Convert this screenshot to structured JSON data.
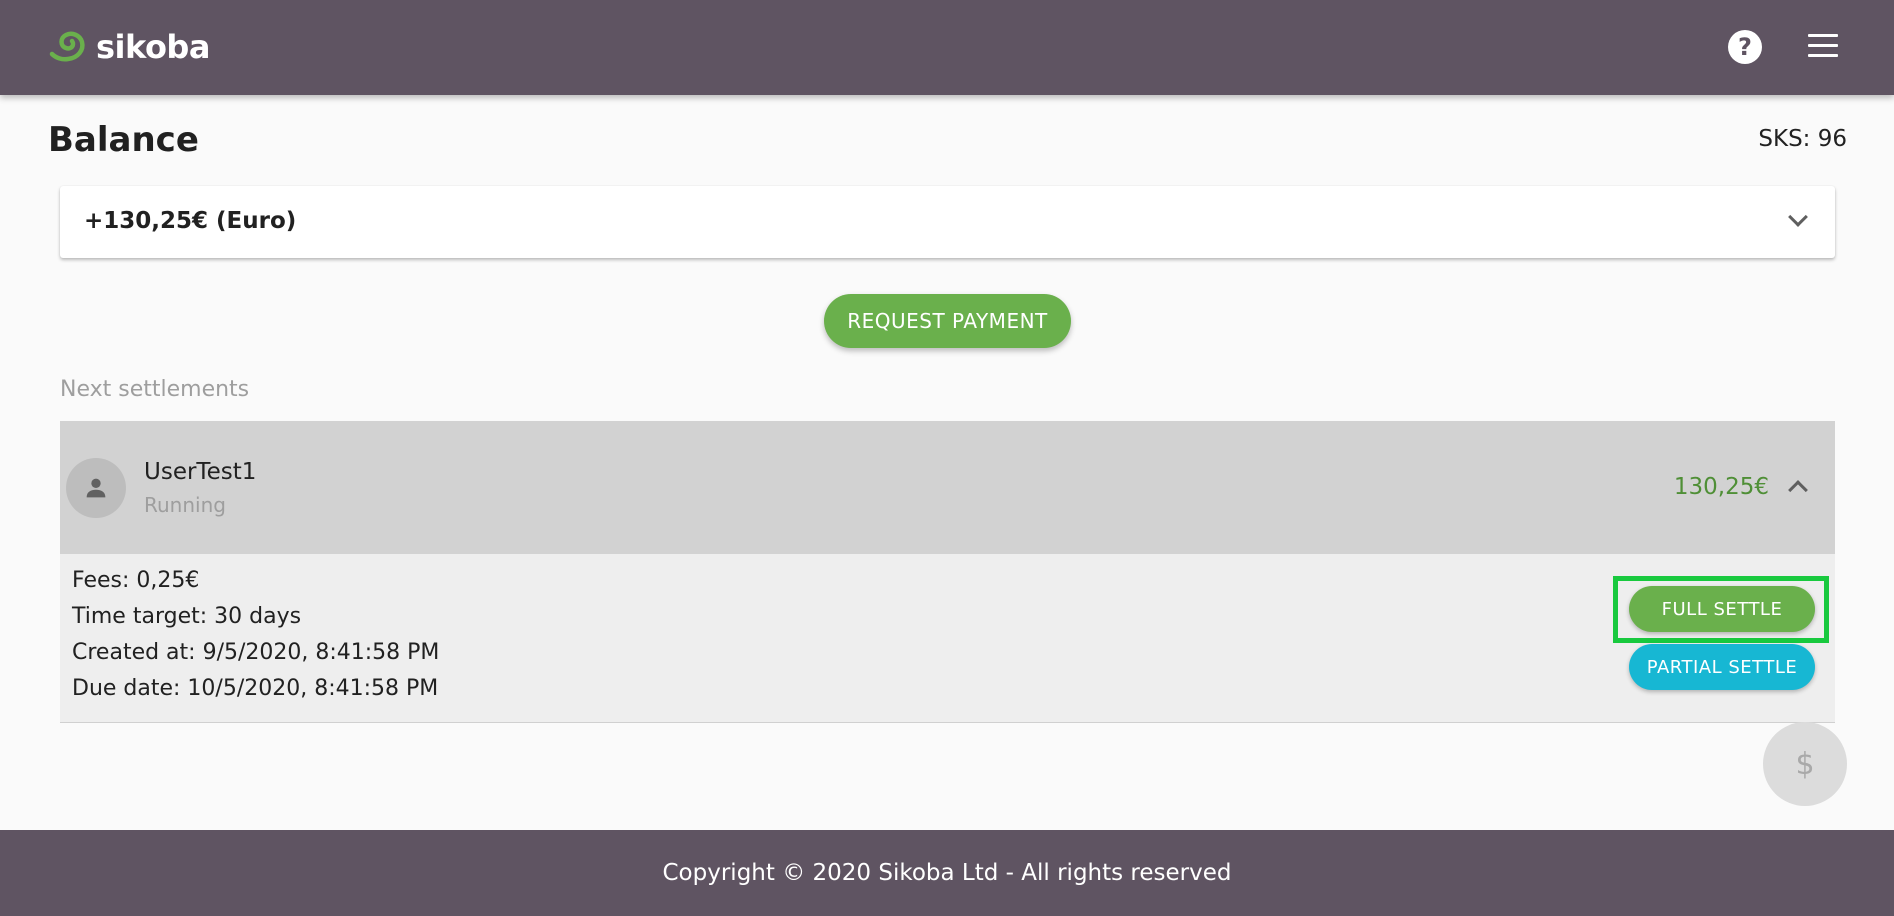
{
  "header": {
    "logo_text": "sikoba",
    "help_icon": "help-circle-icon",
    "menu_icon": "hamburger-menu-icon"
  },
  "balance": {
    "title": "Balance",
    "sks": "SKS: 96",
    "currency_selector": "+130,25€ (Euro)"
  },
  "actions": {
    "request_payment": "REQUEST PAYMENT"
  },
  "settlements": {
    "section_label": "Next settlements",
    "items": [
      {
        "user": "UserTest1",
        "status": "Running",
        "amount": "130,25€",
        "fees": "Fees: 0,25€",
        "time_target": "Time target: 30 days",
        "created_at": "Created at: 9/5/2020, 8:41:58 PM",
        "due_date": "Due date: 10/5/2020, 8:41:58 PM",
        "full_settle_label": "FULL SETTLE",
        "partial_settle_label": "PARTIAL SETTLE"
      }
    ]
  },
  "fab": {
    "symbol": "$"
  },
  "footer": {
    "copyright": "Copyright © 2020 Sikoba Ltd - All rights reserved"
  },
  "colors": {
    "topbar": "#5f5462",
    "primary_green": "#6ab04c",
    "partial_cyan": "#17b7d3",
    "highlight_frame": "#18c93e",
    "amount_green": "#4f8f36"
  }
}
